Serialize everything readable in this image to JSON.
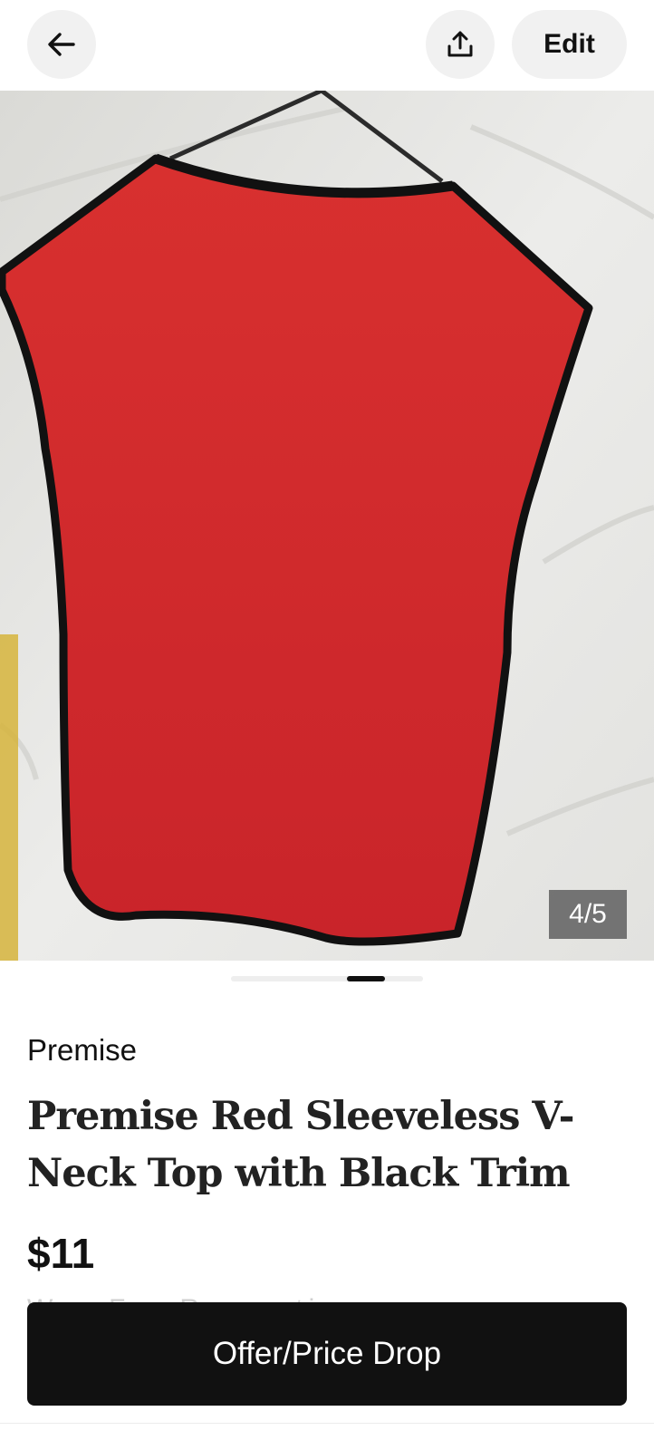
{
  "header": {
    "back_icon": "arrow-left-icon",
    "share_icon": "share-upload-icon",
    "edit_label": "Edit"
  },
  "gallery": {
    "counter": "4/5",
    "active_index": 4,
    "total": 5
  },
  "listing": {
    "brand": "Premise",
    "title": "Premise Red Sleeveless V-Neck Top with Black Trim",
    "price": "$11",
    "partial_line": "W... F... R... ...ti..."
  },
  "cta": {
    "label": "Offer/Price Drop"
  },
  "colors": {
    "accent": "#111111",
    "garment_red": "#d42a2c",
    "trim": "#111111"
  }
}
